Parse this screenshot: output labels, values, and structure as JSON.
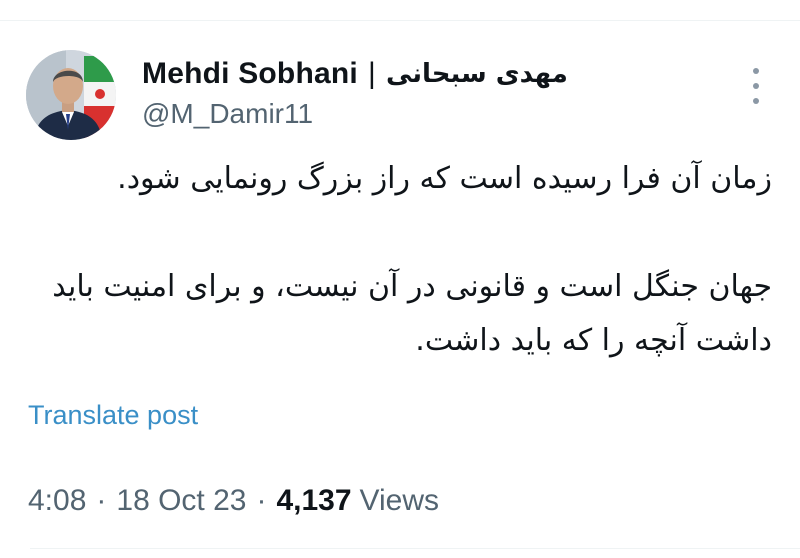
{
  "author": {
    "name_en": "Mehdi Sobhani",
    "separator": "|",
    "name_fa": "مهدی سبحانی",
    "handle": "@M_Damir11"
  },
  "icons": {
    "menu": "more-vertical-icon",
    "avatar": "profile-photo"
  },
  "tweet": {
    "paragraph1": "زمان آن فرا رسیده است که راز بزرگ رونمایی شود.",
    "paragraph2": "جهان جنگل است و قانونی در آن نیست، و برای امنیت باید داشت آنچه را که باید داشت."
  },
  "translate_label": "Translate post",
  "meta": {
    "time": "4:08",
    "dot1": "·",
    "date": "18 Oct 23",
    "dot2": "·",
    "views_count": "4,137",
    "views_label": "Views"
  },
  "colors": {
    "text": "#0f1419",
    "secondary": "#536471",
    "link": "#3a8fc7"
  }
}
